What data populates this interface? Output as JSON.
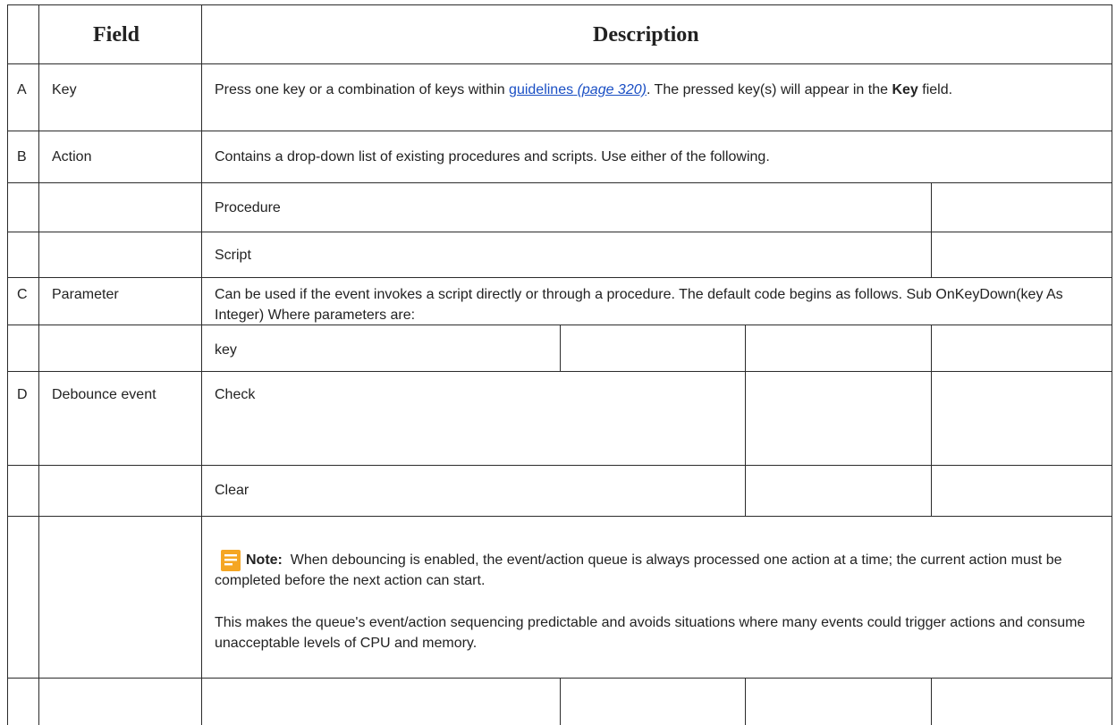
{
  "header": {
    "field": "Field",
    "description": "Description"
  },
  "rows": {
    "a": {
      "letter": "A",
      "field": "Key",
      "desc_before": "Press one key or a combination of keys within ",
      "link_text": "guidelines",
      "link_ref": "(page 320)",
      "desc_mid": ". The pressed key(s) will appear in the ",
      "desc_bold": "Key",
      "desc_after": " field."
    },
    "b": {
      "letter": "B",
      "field": "Action",
      "desc": "Contains a drop-down list of existing procedures and scripts. Use either of the following.",
      "sub1": "Procedure",
      "sub2": "Script"
    },
    "c": {
      "letter": "C",
      "field": "Parameter",
      "desc": "Can be used if the event invokes a script directly or through a procedure. The default code begins as follows. Sub OnKeyDown(key As Integer) Where parameters are:",
      "sub1": "key"
    },
    "d": {
      "letter": "D",
      "field": "Debounce event",
      "sub1": "Check",
      "sub2": "Clear"
    }
  },
  "note": {
    "icon": "note-icon",
    "label": "Note:",
    "text1": "When debouncing is enabled, the event/action queue is always processed one action at a time; the current action must be completed before the next action can start.",
    "text2": "This makes the queue's event/action sequencing predictable and avoids situations where many events could trigger actions and consume unacceptable levels of CPU and memory."
  },
  "colors": {
    "border": "#2b2b2b",
    "link": "#1a4fc4",
    "note_icon": "#f5a623"
  }
}
